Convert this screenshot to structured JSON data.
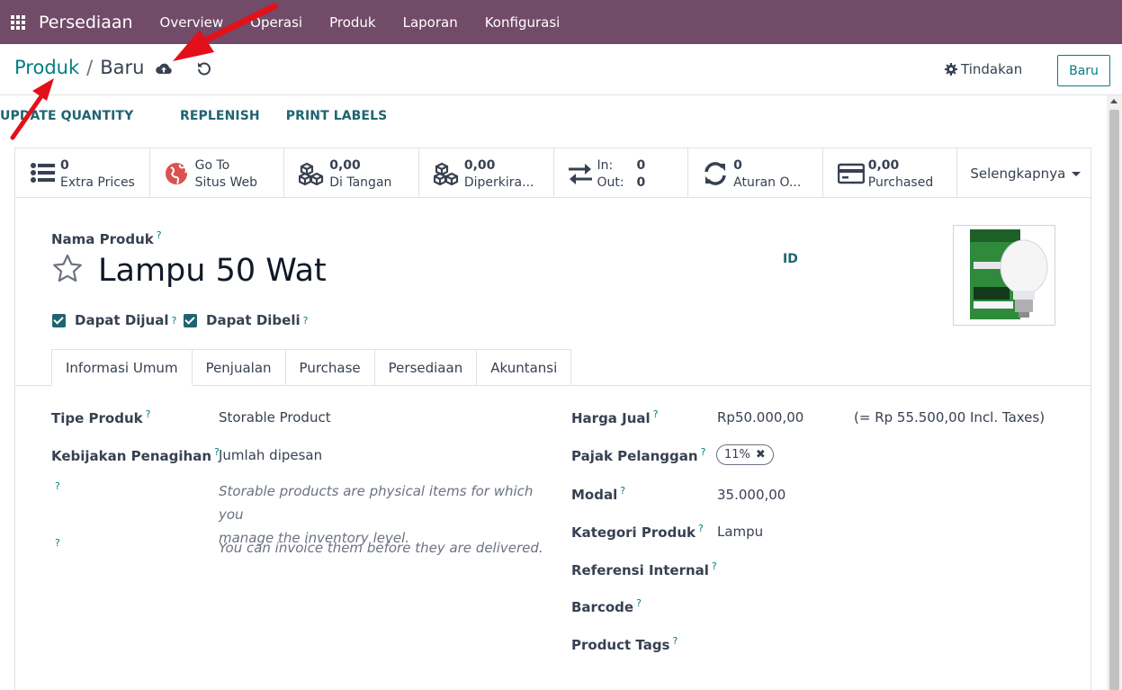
{
  "navbar": {
    "app_name": "Persediaan",
    "menu": [
      "Overview",
      "Operasi",
      "Produk",
      "Laporan",
      "Konfigurasi"
    ]
  },
  "breadcrumb": {
    "parent": "Produk",
    "separator": "/",
    "current": "Baru"
  },
  "control": {
    "actions_label": "Tindakan",
    "new_label": "Baru"
  },
  "header_buttons": [
    "UPDATE QUANTITY",
    "REPLENISH",
    "PRINT LABELS"
  ],
  "smart_buttons": {
    "extra_prices": {
      "value": "0",
      "label": "Extra Prices"
    },
    "website": {
      "line1": "Go To",
      "line2": "Situs Web"
    },
    "on_hand": {
      "value": "0,00",
      "label": "Di Tangan"
    },
    "forecast": {
      "value": "0,00",
      "label": "Diperkira..."
    },
    "in_out": {
      "in_label": "In:",
      "in_value": "0",
      "out_label": "Out:",
      "out_value": "0"
    },
    "rules": {
      "value": "0",
      "label": "Aturan O..."
    },
    "purchased": {
      "value": "0,00",
      "label": "Purchased"
    },
    "more": "Selengkapnya"
  },
  "product": {
    "name_label": "Nama Produk",
    "name": "Lampu 50 Wat",
    "id_label": "ID",
    "help": "?",
    "can_be_sold": "Dapat Dijual",
    "can_be_purchased": "Dapat Dibeli"
  },
  "tabs": [
    "Informasi Umum",
    "Penjualan",
    "Purchase",
    "Persediaan",
    "Akuntansi"
  ],
  "left_fields": {
    "type_label": "Tipe Produk",
    "type_value": "Storable Product",
    "invoice_label": "Kebijakan Penagihan",
    "invoice_value": "Jumlah dipesan",
    "note1": "Storable products are physical items for which you manage the inventory level.",
    "note1_a": "Storable products are physical items for which you",
    "note1_b": "manage the inventory level.",
    "note2": "You can invoice them before they are delivered."
  },
  "right_fields": {
    "price_label": "Harga Jual",
    "price_value": "Rp50.000,00",
    "price_incl": "(= Rp 55.500,00 Incl. Taxes)",
    "tax_label": "Pajak Pelanggan",
    "tax_value": "11%",
    "cost_label": "Modal",
    "cost_value": "35.000,00",
    "category_label": "Kategori Produk",
    "category_value": "Lampu",
    "ref_label": "Referensi Internal",
    "barcode_label": "Barcode",
    "tags_label": "Product Tags"
  },
  "colors": {
    "navbar": "#714b67",
    "accent": "#017e84",
    "arrow": "#e3101a"
  }
}
